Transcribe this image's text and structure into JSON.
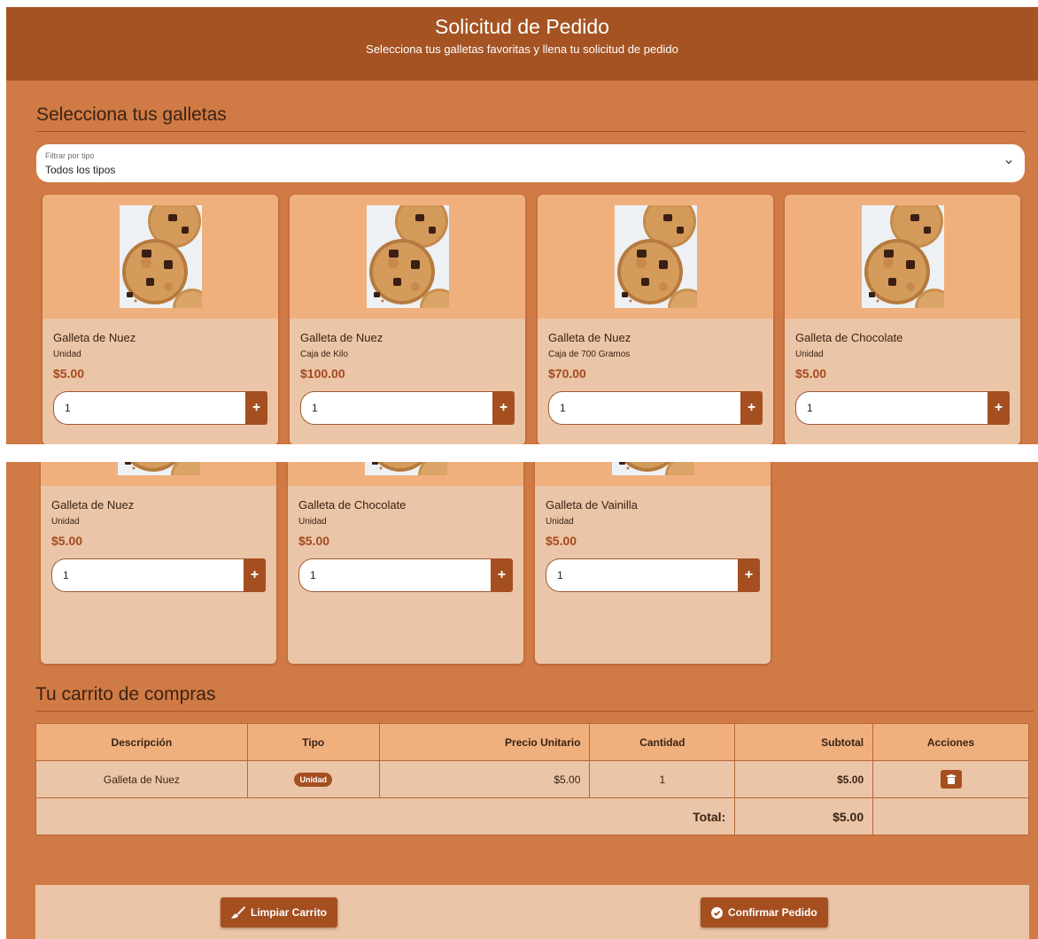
{
  "header": {
    "title": "Solicitud de Pedido",
    "subtitle": "Selecciona tus galletas favoritas y llena tu solicitud de pedido"
  },
  "selection": {
    "title": "Selecciona tus galletas",
    "filter_label": "Filtrar por tipo",
    "filter_value": "Todos los tipos"
  },
  "products_top": [
    {
      "name": "Galleta de Nuez",
      "type": "Unidad",
      "price": "$5.00",
      "qty": "1",
      "add": "+"
    },
    {
      "name": "Galleta de Nuez",
      "type": "Caja de Kilo",
      "price": "$100.00",
      "qty": "1",
      "add": "+"
    },
    {
      "name": "Galleta de Nuez",
      "type": "Caja de 700 Gramos",
      "price": "$70.00",
      "qty": "1",
      "add": "+"
    },
    {
      "name": "Galleta de Chocolate",
      "type": "Unidad",
      "price": "$5.00",
      "qty": "1",
      "add": "+"
    }
  ],
  "products_bottom": [
    {
      "name": "Galleta de Nuez",
      "type": "Unidad",
      "price": "$5.00",
      "qty": "1",
      "add": "+"
    },
    {
      "name": "Galleta de Chocolate",
      "type": "Unidad",
      "price": "$5.00",
      "qty": "1",
      "add": "+"
    },
    {
      "name": "Galleta de Vainilla",
      "type": "Unidad",
      "price": "$5.00",
      "qty": "1",
      "add": "+"
    }
  ],
  "cart": {
    "title": "Tu carrito de compras",
    "headers": [
      "Descripción",
      "Tipo",
      "Precio Unitario",
      "Cantidad",
      "Subtotal",
      "Acciones"
    ],
    "rows": [
      {
        "description": "Galleta de Nuez",
        "type": "Unidad",
        "unit_price": "$5.00",
        "quantity": "1",
        "subtotal": "$5.00"
      }
    ],
    "total_label": "Total:",
    "total_value": "$5.00"
  },
  "actions": {
    "clear_label": "Limpiar Carrito",
    "confirm_label": "Confirmar Pedido"
  },
  "colors": {
    "header_bg": "#a55323",
    "page_bg": "#d07a45",
    "card_bg": "#ebc5a7",
    "card_image_bg": "#f0b07e",
    "accent": "#a54f21"
  },
  "icons": {
    "filter_dropdown": "chevron-down-icon",
    "product_image": "cookie-image",
    "remove_item": "trash-icon",
    "clear_cart": "brush-icon",
    "confirm_order": "check-circle-icon"
  }
}
